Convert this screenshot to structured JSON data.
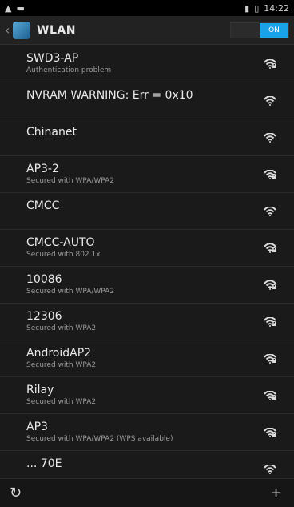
{
  "status_bar": {
    "left_icons": [
      "alert-icon",
      "phone-icon"
    ],
    "right_icons": [
      "signal-icon",
      "battery-icon"
    ],
    "time": "14:22"
  },
  "action_bar": {
    "title": "WLAN",
    "toggle_on_label": "ON"
  },
  "networks": [
    {
      "ssid": "SWD3-AP",
      "subtitle": "Authentication problem",
      "icon": "wifi-lock-icon"
    },
    {
      "ssid": "NVRAM WARNING: Err = 0x10",
      "subtitle": "",
      "icon": "wifi-icon"
    },
    {
      "ssid": "Chinanet",
      "subtitle": "",
      "icon": "wifi-icon"
    },
    {
      "ssid": "AP3-2",
      "subtitle": "Secured with WPA/WPA2",
      "icon": "wifi-lock-icon"
    },
    {
      "ssid": "CMCC",
      "subtitle": "",
      "icon": "wifi-icon"
    },
    {
      "ssid": "CMCC-AUTO",
      "subtitle": "Secured with 802.1x",
      "icon": "wifi-lock-icon"
    },
    {
      "ssid": "10086",
      "subtitle": "Secured with WPA/WPA2",
      "icon": "wifi-lock-icon"
    },
    {
      "ssid": "12306",
      "subtitle": "Secured with WPA2",
      "icon": "wifi-lock-icon"
    },
    {
      "ssid": "AndroidAP2",
      "subtitle": "Secured with WPA2",
      "icon": "wifi-lock-icon"
    },
    {
      "ssid": "Rilay",
      "subtitle": "Secured with WPA2",
      "icon": "wifi-lock-icon"
    },
    {
      "ssid": "AP3",
      "subtitle": "Secured with WPA/WPA2 (WPS available)",
      "icon": "wifi-lock-icon"
    },
    {
      "ssid": "... 70E",
      "subtitle": "",
      "icon": "wifi-icon"
    }
  ],
  "bottom_bar": {
    "left_icon": "refresh-icon",
    "right_icon": "add-icon"
  }
}
